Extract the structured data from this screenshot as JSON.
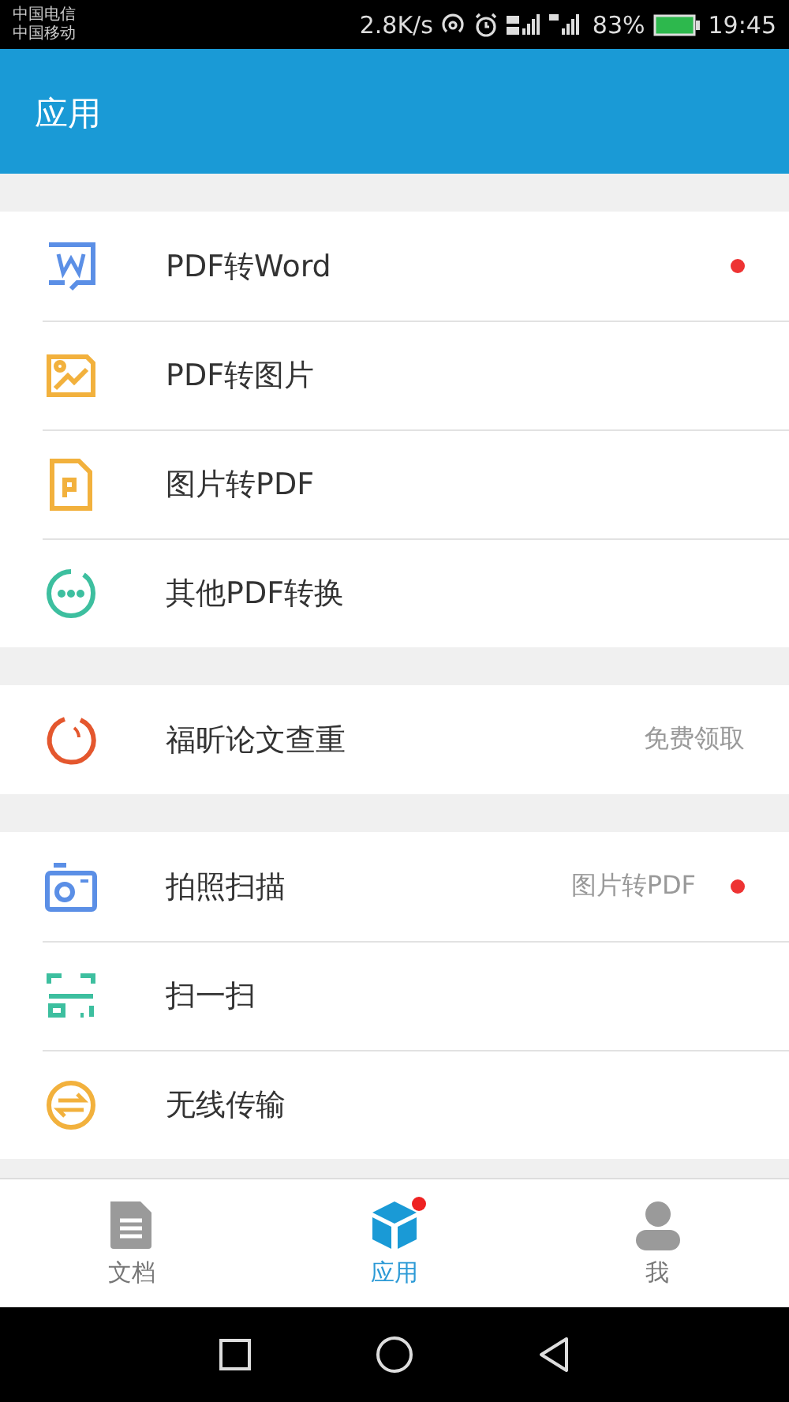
{
  "status_bar": {
    "carriers": [
      "中国电信",
      "中国移动"
    ],
    "speed": "2.8K/s",
    "battery": "83%",
    "time": "19:45"
  },
  "app_bar": {
    "title": "应用"
  },
  "groups": [
    {
      "items": [
        {
          "kind": "word",
          "label": "PDF转Word",
          "dot": true
        },
        {
          "kind": "image",
          "label": "PDF转图片",
          "dot": false
        },
        {
          "kind": "pdf",
          "label": "图片转PDF",
          "dot": false
        },
        {
          "kind": "more",
          "label": "其他PDF转换",
          "dot": false
        }
      ]
    },
    {
      "items": [
        {
          "kind": "check",
          "label": "福昕论文查重",
          "hint": "免费领取",
          "dot": false
        }
      ]
    },
    {
      "items": [
        {
          "kind": "camera",
          "label": "拍照扫描",
          "hint": "图片转PDF",
          "dot": true
        },
        {
          "kind": "scan",
          "label": "扫一扫",
          "dot": false
        },
        {
          "kind": "transfer",
          "label": "无线传输",
          "dot": false
        }
      ]
    }
  ],
  "tabs": [
    {
      "kind": "doc",
      "label": "文档",
      "selected": false,
      "dot": false
    },
    {
      "kind": "box",
      "label": "应用",
      "selected": true,
      "dot": true
    },
    {
      "kind": "user",
      "label": "我",
      "selected": false,
      "dot": false
    }
  ]
}
